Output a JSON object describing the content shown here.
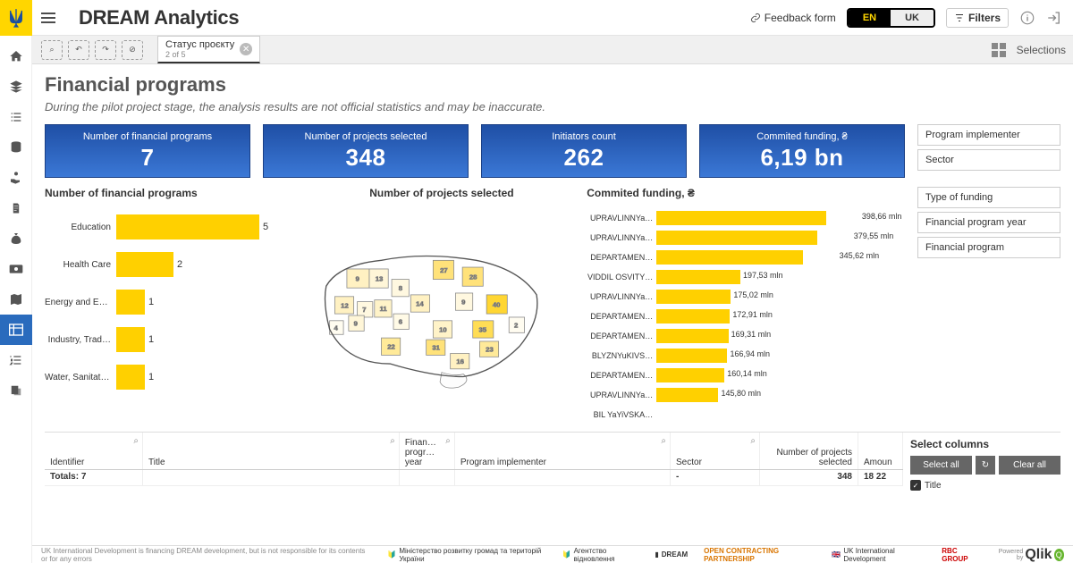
{
  "header": {
    "app_title": "DREAM Analytics",
    "feedback_label": "Feedback form",
    "lang_active": "EN",
    "lang_inactive": "UK",
    "filters_label": "Filters"
  },
  "tabstrip": {
    "tab_label": "Статус проєкту",
    "tab_sub": "2 of 5",
    "selections_label": "Selections"
  },
  "page": {
    "title": "Financial programs",
    "subtitle": "During the pilot project stage, the analysis results are not official statistics and may be inaccurate."
  },
  "cards": [
    {
      "label": "Number of financial programs",
      "value": "7"
    },
    {
      "label": "Number of projects selected",
      "value": "348"
    },
    {
      "label": "Initiators count",
      "value": "262"
    },
    {
      "label": "Commited funding, ₴",
      "value": "6,19 bn"
    }
  ],
  "filters": [
    "Program implementer",
    "Sector",
    "Type of funding",
    "Financial program year",
    "Financial program"
  ],
  "chart_data": [
    {
      "type": "bar",
      "title": "Number of financial programs",
      "categories": [
        "Education",
        "Health Care",
        "Energy and Ex…",
        "Industry, Trad…",
        "Water, Sanitati…"
      ],
      "values": [
        5,
        2,
        1,
        1,
        1
      ],
      "xlim": [
        0,
        5
      ],
      "orientation": "horizontal"
    },
    {
      "type": "map",
      "title": "Number of projects selected",
      "region_values": [
        9,
        13,
        27,
        28,
        8,
        12,
        7,
        11,
        14,
        9,
        40,
        9,
        6,
        10,
        35,
        2,
        4,
        22,
        31,
        23,
        16
      ],
      "color_scale": [
        "#fff6d5",
        "#ffea99",
        "#ffd633"
      ]
    },
    {
      "type": "bar",
      "title": "Commited funding, ₴",
      "categories": [
        "UPRAVLINNYa…",
        "UPRAVLINNYa…",
        "DEPARTAMEN…",
        "VIDDIL OSVITY…",
        "UPRAVLINNYa…",
        "DEPARTAMEN…",
        "DEPARTAMEN…",
        "BLYZNYuKIVS…",
        "DEPARTAMEN…",
        "UPRAVLINNYa…",
        "BIL YaYiVSKA…"
      ],
      "values": [
        398.66,
        379.55,
        345.62,
        197.53,
        175.02,
        172.91,
        169.31,
        166.94,
        160.14,
        145.8,
        0
      ],
      "value_labels": [
        "398,66 mln",
        "379,55 mln",
        "345,62 mln",
        "197,53 mln",
        "175,02 mln",
        "172,91 mln",
        "169,31 mln",
        "166,94 mln",
        "160,14 mln",
        "145,80 mln",
        ""
      ],
      "xlim": [
        0,
        400
      ],
      "orientation": "horizontal"
    }
  ],
  "table": {
    "columns": [
      "Identifier",
      "Title",
      "Finan… progr… year",
      "Program implementer",
      "Sector",
      "Number of projects selected",
      "Amoun"
    ],
    "totals_label": "Totals: 7",
    "totals": {
      "sector": "-",
      "projects": "348",
      "amount": "18 22"
    }
  },
  "select_columns": {
    "header": "Select columns",
    "select_all": "Select all",
    "clear_all": "Clear all",
    "items": [
      "Title"
    ]
  },
  "footer": {
    "disclaimer": "UK International Development is financing DREAM development, but is not responsible for its contents or for any errors",
    "brands": [
      "Міністерство розвитку громад та територій України",
      "Агентство відновлення",
      "DREAM",
      "OPEN CONTRACTING PARTNERSHIP",
      "UK International Development",
      "RBC GROUP"
    ],
    "powered": "Powered by",
    "qlik": "Qlik"
  }
}
